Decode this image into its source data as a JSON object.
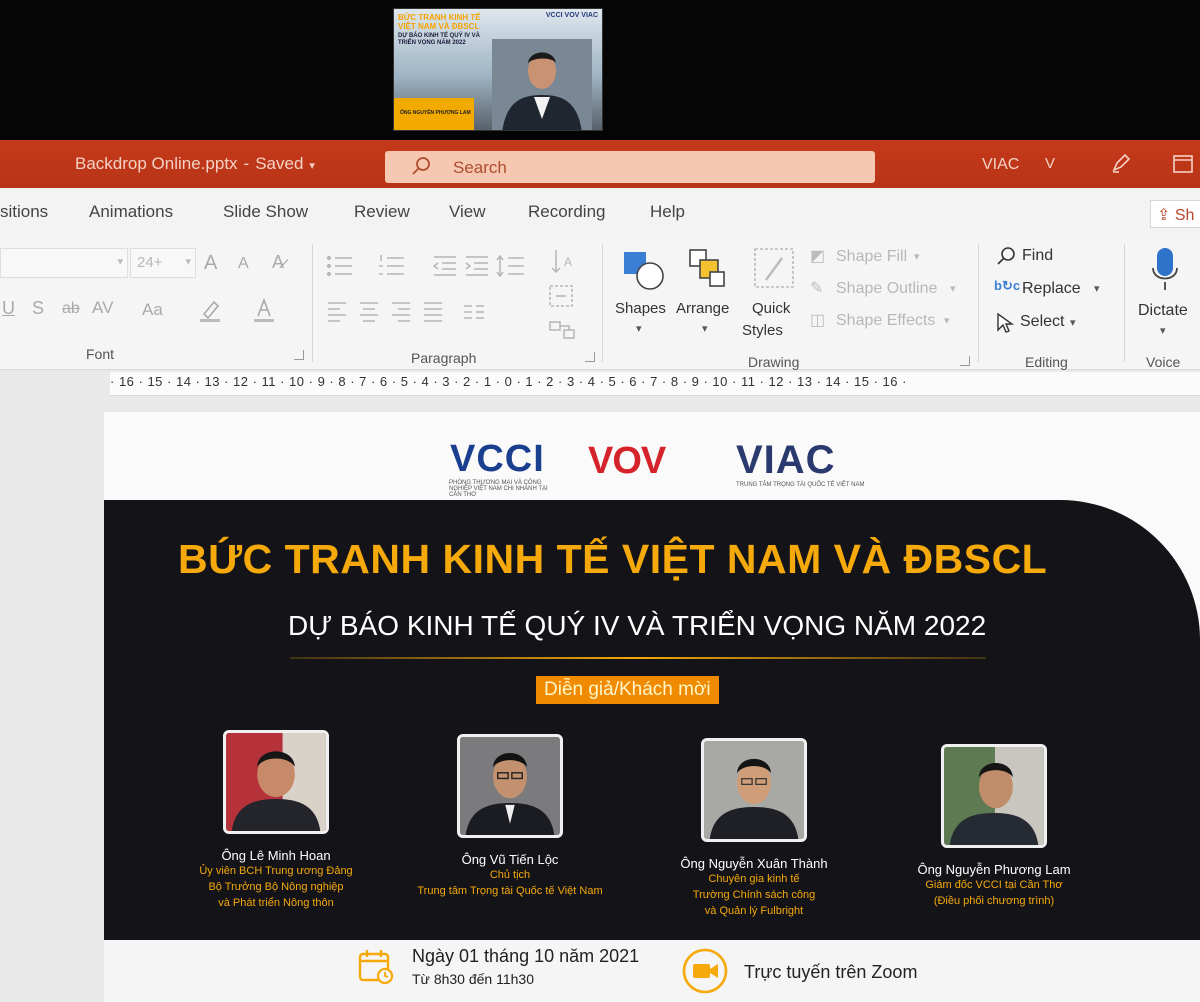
{
  "video_call": {
    "thumbnail_title": "BỨC TRANH KINH TẾ VIỆT NAM VÀ ĐBSCL",
    "thumbnail_subtitle": "DỰ BÁO KINH TẾ QUÝ IV VÀ TRIỂN VỌNG NĂM 2022",
    "thumbnail_logos": "VCCI VOV VIAC",
    "thumbnail_name": "ÔNG NGUYỄN PHƯƠNG LAM"
  },
  "titlebar": {
    "filename": "Backdrop Online.pptx",
    "separator": "-",
    "status": "Saved",
    "account": "VIAC",
    "avatar_initial": "V",
    "colors": {
      "bar": "#c5391a",
      "search": "#f6c8b2"
    }
  },
  "search": {
    "placeholder": "Search"
  },
  "tabs": [
    "sitions",
    "Animations",
    "Slide Show",
    "Review",
    "View",
    "Recording",
    "Help"
  ],
  "share_label": "Sh",
  "ribbon": {
    "font": {
      "label": "Font",
      "size": "24+",
      "grow": "A",
      "shrink": "A",
      "underline": "U",
      "shadow": "S",
      "strike": "ab",
      "spacing": "AV",
      "case": "Aa"
    },
    "paragraph": {
      "label": "Paragraph"
    },
    "drawing": {
      "label": "Drawing",
      "shapes": "Shapes",
      "arrange": "Arrange",
      "quick_styles_1": "Quick",
      "quick_styles_2": "Styles",
      "shape_fill": "Shape Fill",
      "shape_outline": "Shape Outline",
      "shape_effects": "Shape Effects"
    },
    "editing": {
      "label": "Editing",
      "find": "Find",
      "replace": "Replace",
      "select": "Select"
    },
    "voice": {
      "label": "Voice",
      "dictate": "Dictate"
    }
  },
  "ruler": {
    "text": "· 16 · 15 · 14 · 13 · 12 · 11 · 10 · 9 · 8 · 7 · 6 · 5 · 4 · 3 · 2 · 1 · 0 · 1 · 2 · 3 · 4 · 5 · 6 · 7 · 8 · 9 · 10 · 11 · 12 · 13 · 14 · 15 · 16 ·"
  },
  "slide": {
    "logos": {
      "vcci": "VCCI",
      "vcci_sub": "PHÒNG THƯƠNG MẠI VÀ CÔNG NGHIỆP VIỆT NAM CHI NHÁNH TẠI CẦN THƠ",
      "vov": "VOV",
      "viac": "VIAC",
      "viac_sub": "TRUNG TÂM TRỌNG TÀI QUỐC TẾ VIỆT NAM"
    },
    "title": "BỨC TRANH KINH TẾ VIỆT NAM VÀ ĐBSCL",
    "subtitle": "DỰ BÁO KINH TẾ QUÝ IV VÀ TRIỂN VỌNG NĂM 2022",
    "speakers_badge": "Diễn giả/Khách mời",
    "speakers": [
      {
        "name": "Ông Lê Minh Hoan",
        "role1": "Ủy viên BCH Trung ương Đảng",
        "role2": "Bộ Trưởng Bộ Nông nghiệp",
        "role3": "và Phát triển Nông thôn"
      },
      {
        "name": "Ông Vũ Tiến Lộc",
        "role1": "Chủ tịch",
        "role2": "Trung tâm Trọng tài Quốc tế Việt Nam",
        "role3": ""
      },
      {
        "name": "Ông Nguyễn Xuân Thành",
        "role1": "Chuyên gia kinh tế",
        "role2": "Trường Chính sách công",
        "role3": "và Quản lý Fulbright"
      },
      {
        "name": "Ông Nguyễn Phương Lam",
        "role1": "Giám đốc VCCI tại Cần Thơ",
        "role2": "(Điều phối chương trình)",
        "role3": ""
      }
    ],
    "event": {
      "date": "Ngày 01 tháng 10 năm 2021",
      "time": "Từ 8h30 đến 11h30",
      "online": "Trực tuyến trên Zoom"
    },
    "colors": {
      "gold": "#f5a90a",
      "dark": "#141418",
      "badge": "#f08a00"
    }
  }
}
